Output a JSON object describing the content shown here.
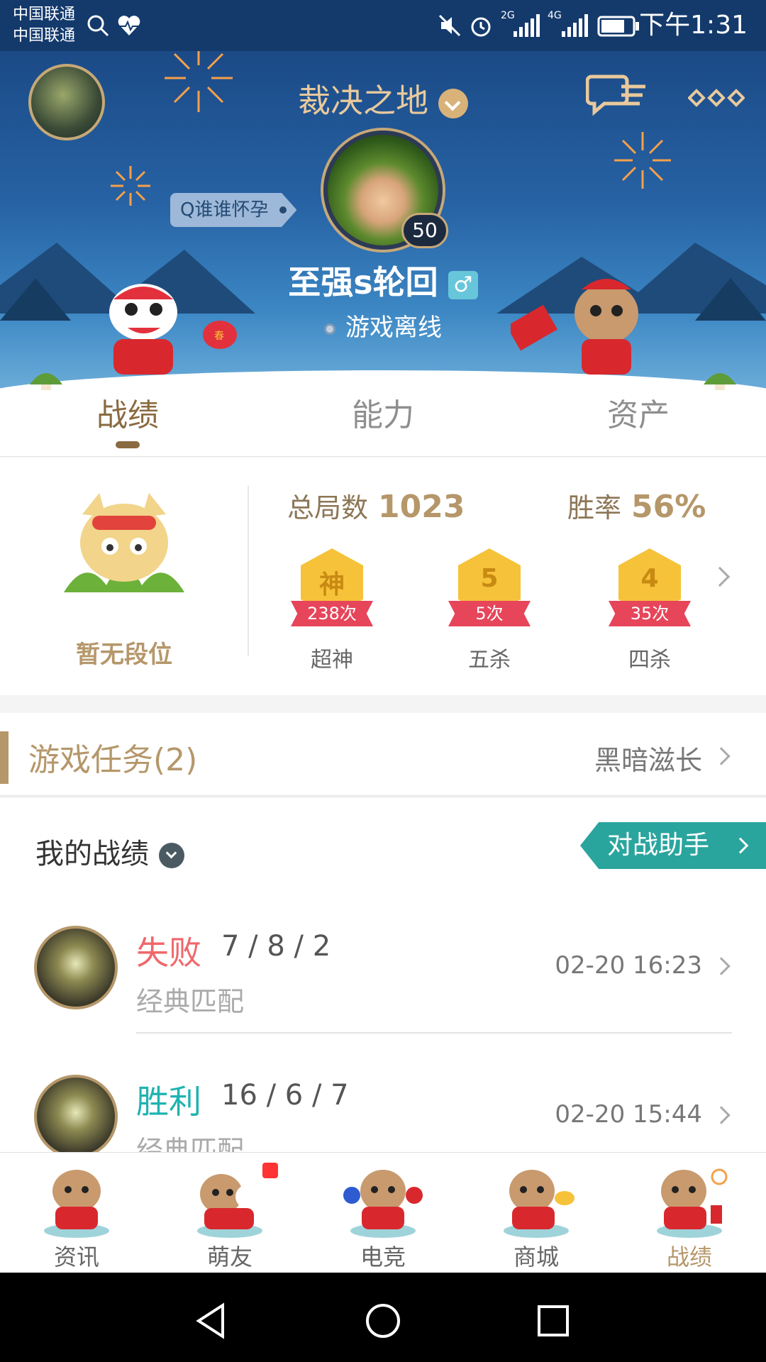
{
  "status_bar": {
    "carrier_1": "中国联通",
    "carrier_2": "中国联通",
    "time": "下午1:31",
    "network_1": "2G",
    "network_2": "4G"
  },
  "header": {
    "server_name": "裁决之地",
    "tag": "Q谁谁怀孕",
    "level": "50",
    "nickname": "至强s轮回",
    "gender_symbol": "♂",
    "status": "游戏离线"
  },
  "tabs": [
    {
      "label": "战绩",
      "active": true
    },
    {
      "label": "能力",
      "active": false
    },
    {
      "label": "资产",
      "active": false
    }
  ],
  "stats": {
    "rank": "暂无段位",
    "total_label": "总局数",
    "total_value": "1023",
    "winrate_label": "胜率",
    "winrate_value": "56%",
    "badges": [
      {
        "symbol": "神",
        "count": "238次",
        "label": "超神"
      },
      {
        "symbol": "5",
        "count": "5次",
        "label": "五杀"
      },
      {
        "symbol": "4",
        "count": "35次",
        "label": "四杀"
      }
    ]
  },
  "tasks": {
    "title": "游戏任务(2)",
    "right_text": "黑暗滋长"
  },
  "records": {
    "title": "我的战绩",
    "assist_button": "对战助手",
    "matches": [
      {
        "result": "失败",
        "kda": "7 / 8 / 2",
        "mode": "经典匹配",
        "time": "02-20 16:23",
        "result_color": "#f0676a"
      },
      {
        "result": "胜利",
        "kda": "16 / 6 / 7",
        "mode": "经典匹配",
        "time": "02-20 15:44",
        "result_color": "#1fb3b0"
      }
    ]
  },
  "bottom_nav": [
    {
      "label": "资讯",
      "active": false
    },
    {
      "label": "萌友",
      "active": false,
      "badge": true
    },
    {
      "label": "电竞",
      "active": false
    },
    {
      "label": "商城",
      "active": false
    },
    {
      "label": "战绩",
      "active": true
    }
  ],
  "colors": {
    "accent_gold": "#b5976a",
    "teal": "#2aa59e",
    "loss": "#f0676a",
    "win": "#1fb3b0",
    "header_blue": "#1b4a86"
  }
}
